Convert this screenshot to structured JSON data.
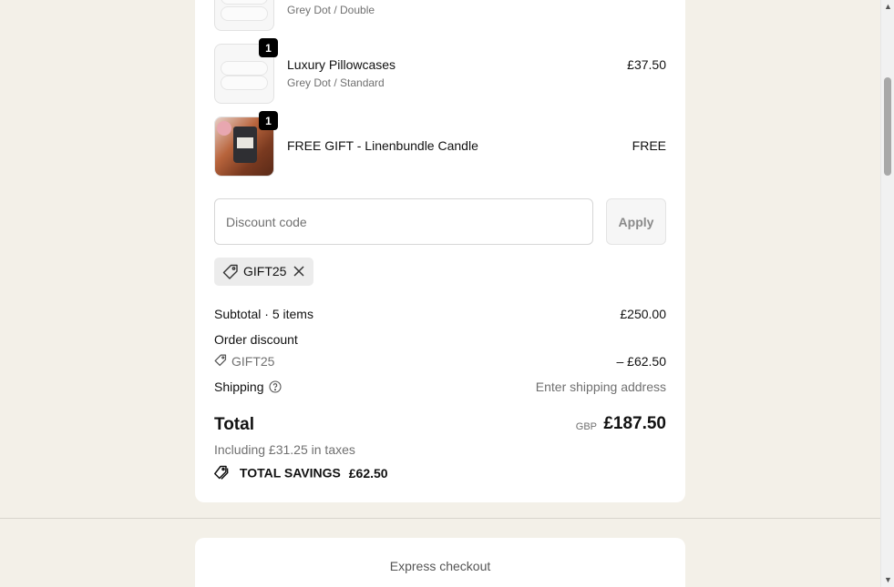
{
  "items": [
    {
      "variant": "Grey Dot / Double",
      "image": "pillow-image"
    },
    {
      "quantity": "1",
      "name": "Luxury Pillowcases",
      "variant": "Grey Dot / Standard",
      "price": "£37.50",
      "image": "pillow-image"
    },
    {
      "quantity": "1",
      "name": "FREE GIFT - Linenbundle Candle",
      "price": "FREE",
      "image": "candle-image"
    }
  ],
  "discount": {
    "placeholder": "Discount code",
    "apply_label": "Apply",
    "applied_code": "GIFT25"
  },
  "summary": {
    "subtotal_label": "Subtotal · 5 items",
    "subtotal_value": "£250.00",
    "order_discount_label": "Order discount",
    "discount_code": "GIFT25",
    "discount_value": "– £62.50",
    "shipping_label": "Shipping",
    "shipping_value": "Enter shipping address",
    "total_label": "Total",
    "currency": "GBP",
    "total_value": "£187.50",
    "taxes_note": "Including £31.25 in taxes",
    "savings_label": "TOTAL SAVINGS",
    "savings_value": "£62.50"
  },
  "express": {
    "title": "Express checkout"
  }
}
